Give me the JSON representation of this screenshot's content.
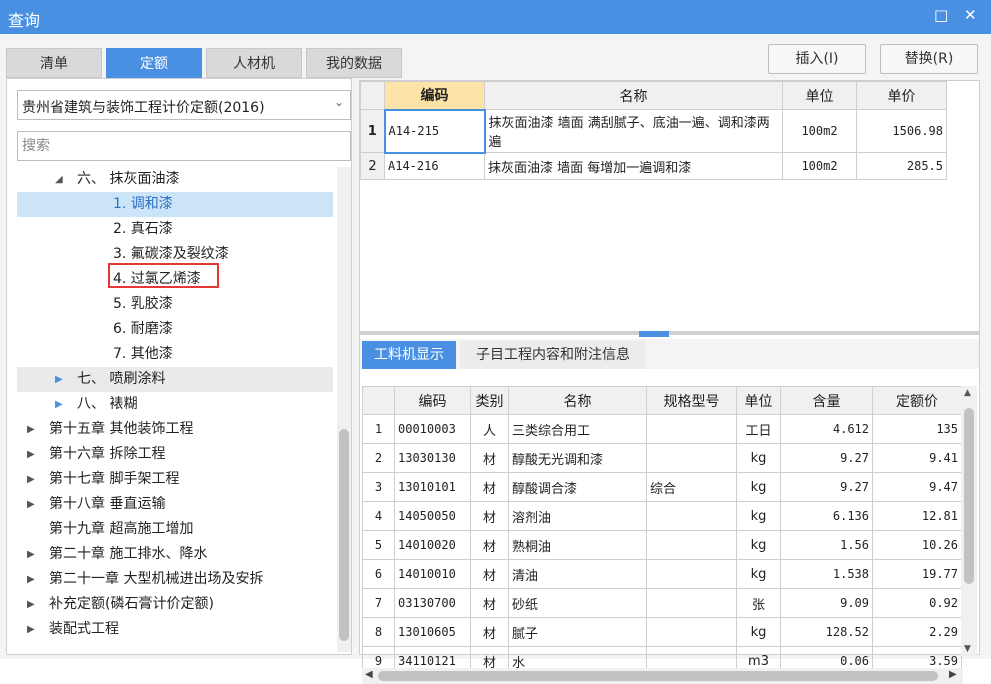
{
  "window": {
    "title": "查询",
    "maximize_glyph": "□",
    "close_glyph": "✕"
  },
  "tabs": [
    "清单",
    "定额",
    "人材机",
    "我的数据"
  ],
  "active_tab": "定额",
  "buttons": {
    "insert": "插入(I)",
    "replace": "替换(R)"
  },
  "left": {
    "dropdown_value": "贵州省建筑与装饰工程计价定额(2016)",
    "search_placeholder": "搜索",
    "tree": [
      {
        "label": "六、 抹灰面油漆",
        "caret": "◢",
        "level": 2
      },
      {
        "label": "1. 调和漆",
        "level": 3,
        "selected": true
      },
      {
        "label": "2. 真石漆",
        "level": 3,
        "boxed": true
      },
      {
        "label": "3. 氟碳漆及裂纹漆",
        "level": 3
      },
      {
        "label": "4. 过氯乙烯漆",
        "level": 3
      },
      {
        "label": "5. 乳胶漆",
        "level": 3
      },
      {
        "label": "6. 耐磨漆",
        "level": 3
      },
      {
        "label": "7. 其他漆",
        "level": 3
      },
      {
        "label": "七、 喷刷涂料",
        "caret": "▶",
        "level": 2,
        "hover": true
      },
      {
        "label": "八、 裱糊",
        "caret": "▶",
        "level": 2
      },
      {
        "label": "第十五章 其他装饰工程",
        "caret": "▶",
        "level": 1
      },
      {
        "label": "第十六章 拆除工程",
        "caret": "▶",
        "level": 1
      },
      {
        "label": "第十七章 脚手架工程",
        "caret": "▶",
        "level": 1
      },
      {
        "label": "第十八章 垂直运输",
        "caret": "▶",
        "level": 1
      },
      {
        "label": "第十九章 超高施工增加",
        "level": 1
      },
      {
        "label": "第二十章 施工排水、降水",
        "caret": "▶",
        "level": 1
      },
      {
        "label": "第二十一章 大型机械进出场及安拆",
        "caret": "▶",
        "level": 1
      },
      {
        "label": "补充定额(磷石膏计价定额)",
        "caret": "▶",
        "level": 1
      },
      {
        "label": "装配式工程",
        "caret": "▶",
        "level": 1
      }
    ]
  },
  "quota_table": {
    "headers": [
      "编码",
      "名称",
      "单位",
      "单价"
    ],
    "rows": [
      {
        "no": "1",
        "code": "A14-215",
        "name": "抹灰面油漆 墙面 满刮腻子、底油一遍、调和漆两遍",
        "unit": "100m2",
        "price": "1506.98"
      },
      {
        "no": "2",
        "code": "A14-216",
        "name": "抹灰面油漆 墙面 每增加一遍调和漆",
        "unit": "100m2",
        "price": "285.5"
      }
    ]
  },
  "lower_tabs": [
    "工料机显示",
    "子目工程内容和附注信息"
  ],
  "materials_table": {
    "headers": [
      "编码",
      "类别",
      "名称",
      "规格型号",
      "单位",
      "含量",
      "定额价"
    ],
    "rows": [
      {
        "no": "1",
        "code": "00010003",
        "type": "人",
        "name": "三类综合用工",
        "spec": "",
        "unit": "工日",
        "qty": "4.612",
        "price": "135"
      },
      {
        "no": "2",
        "code": "13030130",
        "type": "材",
        "name": "醇酸无光调和漆",
        "spec": "",
        "unit": "kg",
        "qty": "9.27",
        "price": "9.41"
      },
      {
        "no": "3",
        "code": "13010101",
        "type": "材",
        "name": "醇酸调合漆",
        "spec": "综合",
        "unit": "kg",
        "qty": "9.27",
        "price": "9.47"
      },
      {
        "no": "4",
        "code": "14050050",
        "type": "材",
        "name": "溶剂油",
        "spec": "",
        "unit": "kg",
        "qty": "6.136",
        "price": "12.81"
      },
      {
        "no": "5",
        "code": "14010020",
        "type": "材",
        "name": "熟桐油",
        "spec": "",
        "unit": "kg",
        "qty": "1.56",
        "price": "10.26"
      },
      {
        "no": "6",
        "code": "14010010",
        "type": "材",
        "name": "清油",
        "spec": "",
        "unit": "kg",
        "qty": "1.538",
        "price": "19.77"
      },
      {
        "no": "7",
        "code": "03130700",
        "type": "材",
        "name": "砂纸",
        "spec": "",
        "unit": "张",
        "qty": "9.09",
        "price": "0.92"
      },
      {
        "no": "8",
        "code": "13010605",
        "type": "材",
        "name": "腻子",
        "spec": "",
        "unit": "kg",
        "qty": "128.52",
        "price": "2.29"
      },
      {
        "no": "9",
        "code": "34110121",
        "type": "材",
        "name": "水",
        "spec": "",
        "unit": "m3",
        "qty": "0.06",
        "price": "3.59"
      }
    ]
  },
  "icons": {
    "dropdown": "chevron-down-icon",
    "expand": "caret-right-icon",
    "collapse": "caret-down-icon"
  }
}
